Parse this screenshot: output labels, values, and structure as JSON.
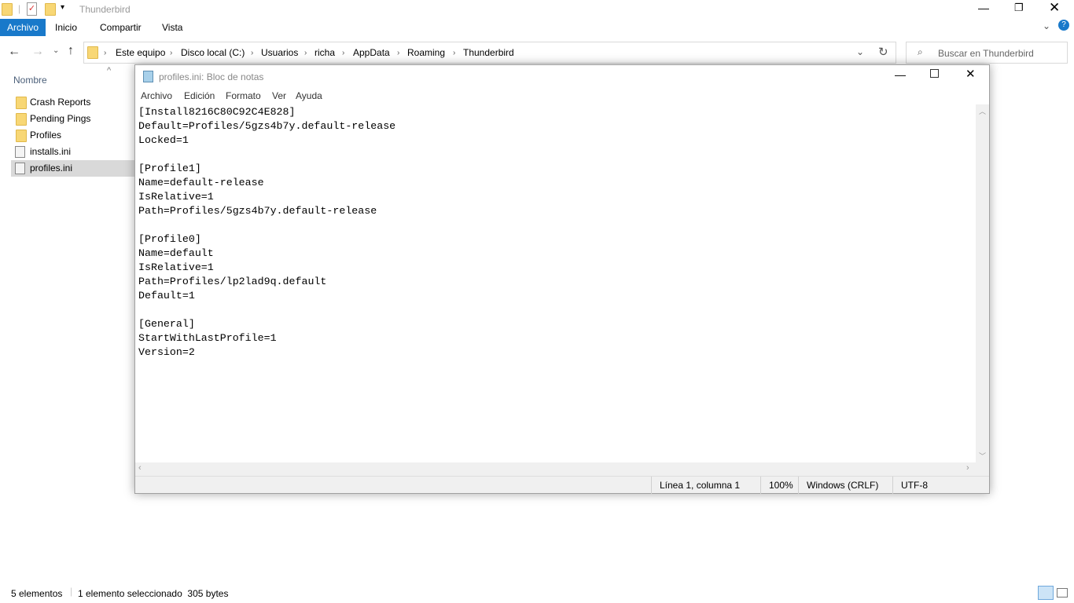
{
  "explorer": {
    "title": "Thunderbird",
    "ribbon_tabs": [
      "Archivo",
      "Inicio",
      "Compartir",
      "Vista"
    ],
    "breadcrumb": [
      "Este equipo",
      "Disco local (C:)",
      "Usuarios",
      "richa",
      "AppData",
      "Roaming",
      "Thunderbird"
    ],
    "search_placeholder": "Buscar en Thunderbird",
    "column_name": "Nombre",
    "files": [
      {
        "name": "Crash Reports",
        "type": "folder"
      },
      {
        "name": "Pending Pings",
        "type": "folder"
      },
      {
        "name": "Profiles",
        "type": "folder"
      },
      {
        "name": "installs.ini",
        "type": "ini"
      },
      {
        "name": "profiles.ini",
        "type": "ini",
        "selected": true
      }
    ],
    "status_count": "5 elementos",
    "status_selected": "1 elemento seleccionado  305 bytes"
  },
  "notepad": {
    "title": "profiles.ini: Bloc de notas",
    "menu": [
      "Archivo",
      "Edición",
      "Formato",
      "Ver",
      "Ayuda"
    ],
    "content": "[Install8216C80C92C4E828]\nDefault=Profiles/5gzs4b7y.default-release\nLocked=1\n\n[Profile1]\nName=default-release\nIsRelative=1\nPath=Profiles/5gzs4b7y.default-release\n\n[Profile0]\nName=default\nIsRelative=1\nPath=Profiles/lp2lad9q.default\nDefault=1\n\n[General]\nStartWithLastProfile=1\nVersion=2",
    "status": {
      "position": "Línea 1, columna 1",
      "zoom": "100%",
      "eol": "Windows (CRLF)",
      "encoding": "UTF-8"
    }
  },
  "colors": {
    "accent": "#1979ca",
    "selected": "#d9d9d9"
  }
}
